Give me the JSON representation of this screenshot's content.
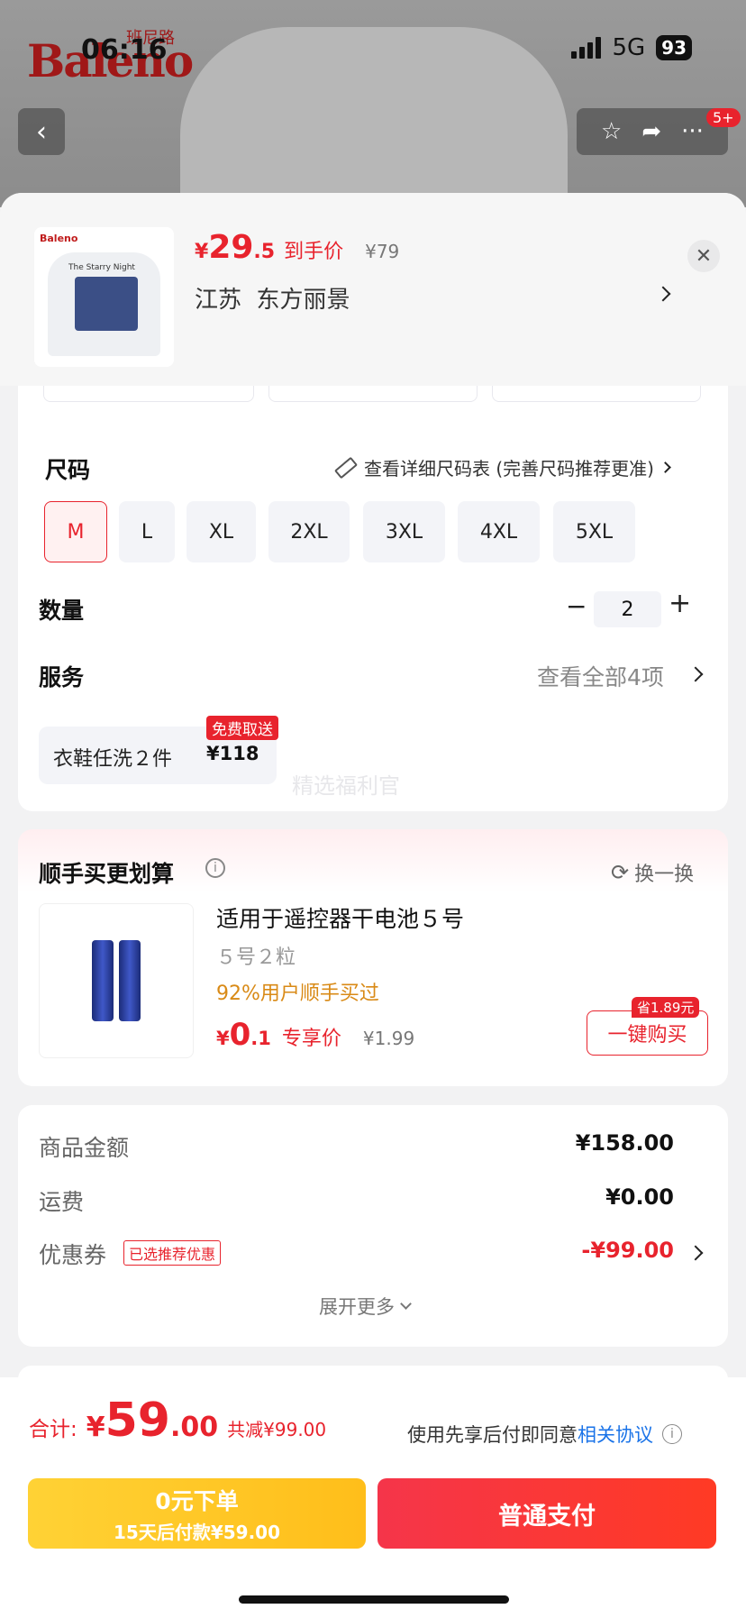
{
  "status_bar": {
    "time": "06:16",
    "network": "5G",
    "battery": "93"
  },
  "background": {
    "brand": "Baleno",
    "brand_cn": "班尼路",
    "cart_badge": "5+"
  },
  "product": {
    "price_symbol": "¥",
    "price_int": "29",
    "price_dec": ".5",
    "price_label": "到手价",
    "original_price": "¥79",
    "location": "江苏  东方丽景",
    "thumb_brand": "Baleno",
    "thumb_text": "The Starry Night"
  },
  "size": {
    "label": "尺码",
    "chart_link": "查看详细尺码表 (完善尺码推荐更准)",
    "options": [
      "M",
      "L",
      "XL",
      "2XL",
      "3XL",
      "4XL",
      "5XL"
    ],
    "selected": "M"
  },
  "quantity": {
    "label": "数量",
    "value": "2",
    "minus": "−",
    "plus": "+"
  },
  "service": {
    "label": "服务",
    "view_all": "查看全部4项",
    "item_name": "衣鞋任洗２件",
    "item_price": "¥118",
    "item_tag": "免费取送",
    "watermark": "精选福利官"
  },
  "addon": {
    "title": "顺手买更划算",
    "refresh": "换一换",
    "product_name": "适用于遥控器干电池５号",
    "spec": "５号２粒",
    "social_proof": "92%用户顺手买过",
    "price_symbol": "¥",
    "price_int": "0",
    "price_dec": ".1",
    "price_label": "专享价",
    "original_price": "¥1.99",
    "save_tag": "省1.89元",
    "buy_button": "一键购买"
  },
  "summary": {
    "goods_label": "商品金额",
    "goods_value": "¥158.00",
    "shipping_label": "运费",
    "shipping_value": "¥0.00",
    "coupon_label": "优惠券",
    "coupon_tag": "已选推荐优惠",
    "coupon_value": "-¥99.00",
    "expand": "展开更多"
  },
  "footer": {
    "total_label": "合计:",
    "total_symbol": "¥",
    "total_int": "59",
    "total_dec": ".00",
    "discount": "共减¥99.00",
    "agreement_prefix": "使用先享后付即同意",
    "agreement_link": "相关协议",
    "bnpl_title": "0元下单",
    "bnpl_sub": "15天后付款¥59.00",
    "pay_button": "普通支付"
  },
  "colors": {
    "accent": "#e8232d",
    "bnpl": "#ffc826",
    "link": "#1a73e8"
  }
}
